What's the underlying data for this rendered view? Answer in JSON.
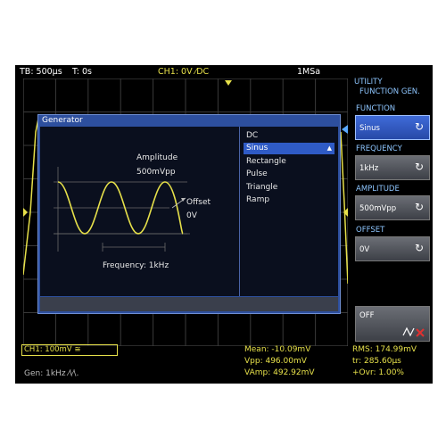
{
  "topbar": {
    "timebase": "TB: 500µs",
    "trigger_time": "T: 0s",
    "channel": "CH1: 0V ⁄DC",
    "sample_rate": "1MSa"
  },
  "menu": {
    "title1": "UTILITY",
    "title2": "FUNCTION GEN.",
    "function": {
      "label": "FUNCTION",
      "value": "Sinus"
    },
    "frequency": {
      "label": "FREQUENCY",
      "value": "1kHz"
    },
    "amplitude": {
      "label": "AMPLITUDE",
      "value": "500mVpp"
    },
    "offset": {
      "label": "OFFSET",
      "value": "0V"
    },
    "off_button": "OFF"
  },
  "dialog": {
    "title": "Generator",
    "amplitude_label": "Amplitude",
    "amplitude_value": "500mVpp",
    "offset_label": "Offset",
    "offset_value": "0V",
    "frequency_label": "Frequency: 1kHz",
    "waveforms": [
      "DC",
      "Sinus",
      "Rectangle",
      "Pulse",
      "Triangle",
      "Ramp"
    ],
    "selected": "Sinus"
  },
  "bottom": {
    "ch1": "CH1: 100mV ≅",
    "gen": "Gen: 1kHz ⁄\\⁄\\.",
    "mean": "Mean: -10.09mV",
    "vpp": "Vpp: 496.00mV",
    "vamp": "VAmp: 492.92mV",
    "rms": "RMS: 174.99mV",
    "tr": "tr: 285.60µs",
    "ovr": "+Ovr: 1.00%"
  },
  "colors": {
    "trace": "#e6e04a",
    "accent": "#2f5bc6",
    "menu_head": "#8ec6ff"
  }
}
